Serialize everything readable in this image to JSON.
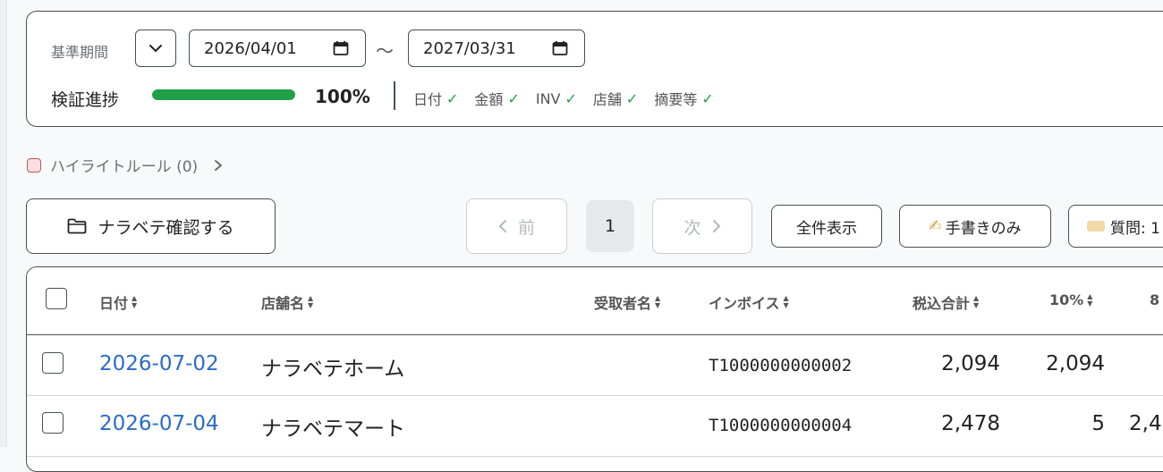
{
  "filter": {
    "period_label": "基準期間",
    "date_from": "2026/04/01",
    "separator": "〜",
    "date_to": "2027/03/31",
    "progress_label": "検証進捗",
    "progress_percent": 100,
    "progress_text": "100%",
    "checks": [
      {
        "label": "日付",
        "done": true
      },
      {
        "label": "金額",
        "done": true
      },
      {
        "label": "INV",
        "done": true
      },
      {
        "label": "店舗",
        "done": true
      },
      {
        "label": "摘要等",
        "done": true
      }
    ]
  },
  "highlight": {
    "label": "ハイライトルール (0)"
  },
  "toolbar": {
    "confirm_label": "ナラベテ確認する",
    "prev_label": "前",
    "current_page": "1",
    "next_label": "次",
    "show_all_label": "全件表示",
    "handwritten_label": "手書きのみ",
    "handwritten_emoji": "✍",
    "question_label": "質問: 1"
  },
  "table": {
    "headers": [
      "日付",
      "店舗名",
      "受取者名",
      "インボイス",
      "税込合計",
      "10%",
      "8"
    ],
    "rows": [
      {
        "date": "2026-07-02",
        "store": "ナラベテホーム",
        "payee": "",
        "invoice": "T1000000000002",
        "total": "2,094",
        "tax10": "2,094",
        "tax8": ""
      },
      {
        "date": "2026-07-04",
        "store": "ナラベテマート",
        "payee": "",
        "invoice": "T1000000000004",
        "total": "2,478",
        "tax10": "5",
        "tax8": "2,4"
      }
    ]
  },
  "colors": {
    "accent_green": "#21a04a",
    "link_blue": "#2a6cc9",
    "border": "#4a4f55"
  }
}
